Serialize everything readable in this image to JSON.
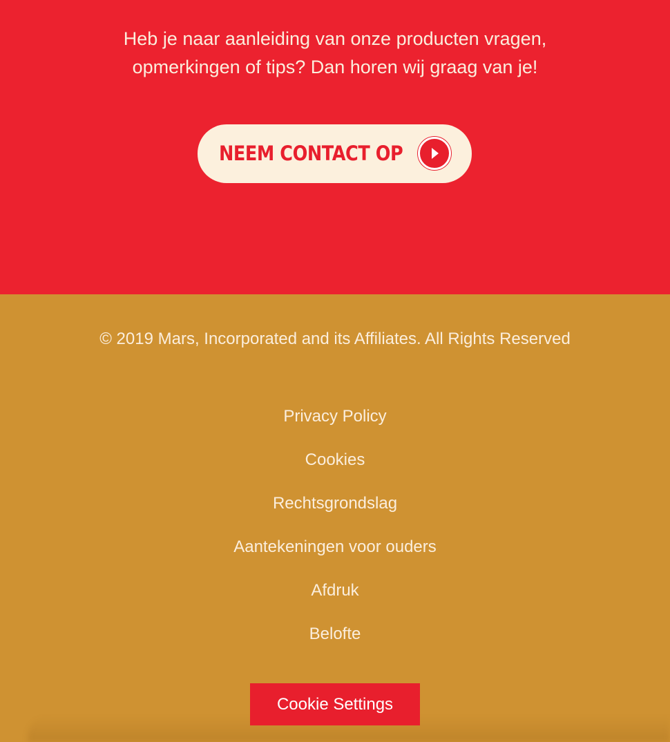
{
  "contact": {
    "text_line1": "Heb je naar aanleiding van onze producten vragen,",
    "text_line2": "opmerkingen of tips? Dan horen wij graag van je!",
    "button_label": "NEEM CONTACT OP",
    "button_icon": "play-arrow-icon"
  },
  "footer": {
    "copyright": "© 2019 Mars, Incorporated and its Affiliates. All Rights Reserved",
    "links": [
      {
        "label": "Privacy Policy"
      },
      {
        "label": "Cookies"
      },
      {
        "label": "Rechtsgrondslag"
      },
      {
        "label": "Aantekeningen voor ouders"
      },
      {
        "label": "Afdruk"
      },
      {
        "label": "Belofte"
      }
    ],
    "cookie_settings_label": "Cookie Settings"
  },
  "colors": {
    "contact_background": "#ec222f",
    "footer_background": "#cf9232",
    "button_background": "#fcf0dd",
    "accent_red": "#e81f2d",
    "text_cream": "#fbeedd"
  }
}
